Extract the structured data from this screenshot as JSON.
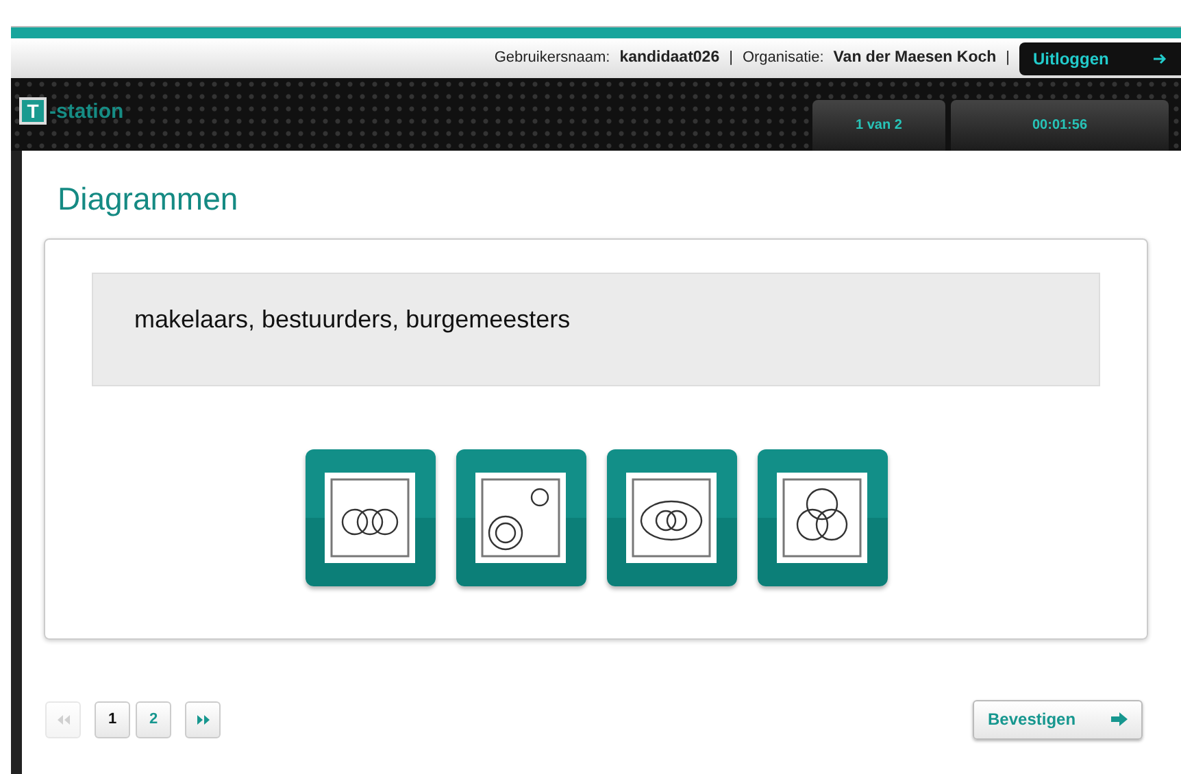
{
  "header": {
    "username_label": "Gebruikersnaam:",
    "username": "kandidaat026",
    "separator_1": "|",
    "organisation_label": "Organisatie:",
    "organisation": "Van der Maesen Koch",
    "separator_2": "|",
    "logout_button": "Uitloggen"
  },
  "logo": {
    "letter": "T",
    "text": "-station"
  },
  "status_tabs": [
    "1 van 2",
    "00:01:56"
  ],
  "page_title": "Diagrammen",
  "question": "makelaars, bestuurders, burgemeesters",
  "options": [
    {
      "kind": "chain",
      "selected": false
    },
    {
      "kind": "nested",
      "selected": false
    },
    {
      "kind": "enclosed",
      "selected": false
    },
    {
      "kind": "venn",
      "selected": false
    }
  ],
  "pagination": {
    "first": {
      "disabled": true
    },
    "pages": [
      {
        "label": "1",
        "selected": true
      },
      {
        "label": "2",
        "selected": false
      }
    ],
    "last": {
      "disabled": false
    }
  },
  "confirm_button": "Bevestigen"
}
